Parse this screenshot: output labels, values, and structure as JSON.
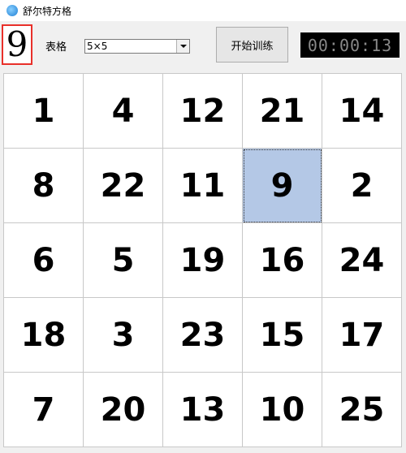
{
  "window": {
    "title": "舒尔特方格"
  },
  "target_number": "9",
  "grid_label": "表格",
  "grid_size_select": {
    "value": "5×5"
  },
  "start_button": "开始训练",
  "timer": "00:00:13",
  "board": {
    "cells": [
      "1",
      "4",
      "12",
      "21",
      "14",
      "8",
      "22",
      "11",
      "9",
      "2",
      "6",
      "5",
      "19",
      "16",
      "24",
      "18",
      "3",
      "23",
      "15",
      "17",
      "7",
      "20",
      "13",
      "10",
      "25"
    ],
    "selected_index": 8
  }
}
